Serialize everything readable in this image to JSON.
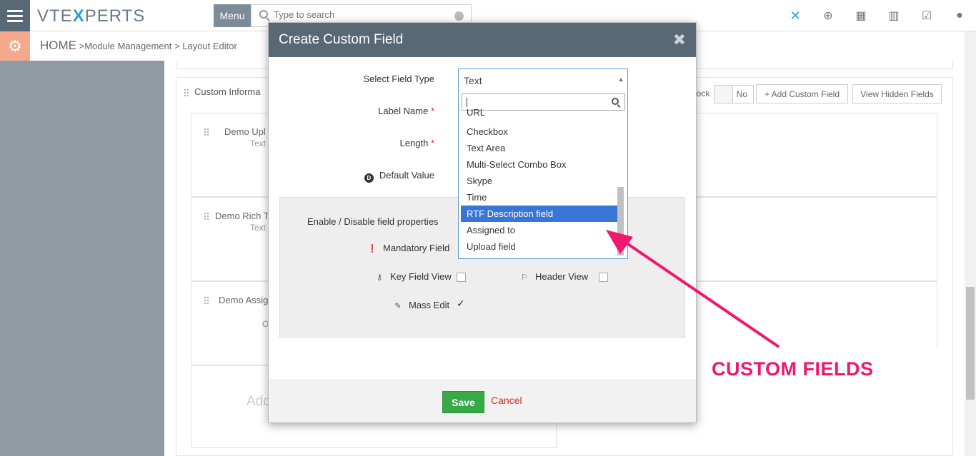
{
  "topbar": {
    "logo_text_a": "VTE",
    "logo_text_x": "X",
    "logo_text_b": "PERTS",
    "menu_label": "Menu",
    "search_placeholder": "Type to search",
    "icons": [
      "vtx-icon",
      "plus-circle-icon",
      "calendar-icon",
      "chart-icon",
      "checkbox-icon",
      "user-icon"
    ]
  },
  "breadcrumb": {
    "home": "HOME",
    "sep": ">",
    "module_management": "Module Management",
    "layout_editor": "Layout Editor"
  },
  "panel": {
    "title": "Custom Informa",
    "block_label": "lock",
    "toggle_no": "No",
    "add_custom_field": "+ Add Custom Field",
    "view_hidden_fields": "View Hidden Fields",
    "fields": [
      {
        "name": "Demo Upl",
        "type": "Text"
      },
      {
        "name": "Demo Rich T",
        "type": "Text"
      },
      {
        "name": "Demo Assig",
        "type": "O"
      }
    ],
    "add_placeholder": "Add"
  },
  "modal": {
    "title": "Create Custom Field",
    "close_icon": "✖",
    "labels": {
      "select_field_type": "Select Field Type",
      "label_name": "Label Name",
      "length": "Length",
      "default_value": "Default Value",
      "required_mark": "*"
    },
    "props": {
      "title": "Enable / Disable field properties",
      "mandatory": "Mandatory Field",
      "key_field_view": "Key Field View",
      "header_view": "Header View",
      "mass_edit": "Mass Edit",
      "mass_edit_checked": true
    },
    "save": "Save",
    "cancel": "Cancel"
  },
  "select": {
    "value": "Text",
    "options": [
      "URL",
      "Checkbox",
      "Text Area",
      "Multi-Select Combo Box",
      "Skype",
      "Time",
      "RTF Description field",
      "Assigned to",
      "Upload field"
    ],
    "active": "RTF Description field"
  },
  "annotation": {
    "text": "CUSTOM FIELDS",
    "color": "#f0176e"
  }
}
